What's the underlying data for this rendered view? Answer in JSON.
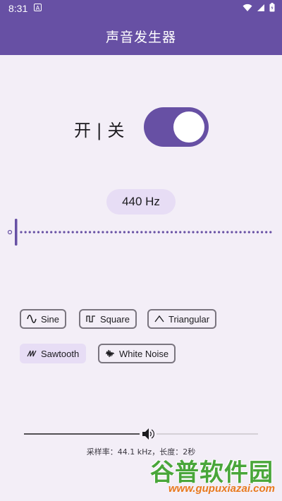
{
  "status_bar": {
    "time": "8:31",
    "notification_glyph": "A"
  },
  "app_bar": {
    "title": "声音发生器"
  },
  "power": {
    "label": "开 | 关",
    "on": true
  },
  "frequency": {
    "label": "440 Hz",
    "value_hz": 440
  },
  "waveforms": [
    {
      "id": "sine",
      "label": "Sine",
      "icon": "sine-wave-icon",
      "selected": false
    },
    {
      "id": "square",
      "label": "Square",
      "icon": "square-wave-icon",
      "selected": false
    },
    {
      "id": "triangular",
      "label": "Triangular",
      "icon": "triangle-wave-icon",
      "selected": false
    },
    {
      "id": "sawtooth",
      "label": "Sawtooth",
      "icon": "sawtooth-wave-icon",
      "selected": true
    },
    {
      "id": "white_noise",
      "label": "White Noise",
      "icon": "noise-wave-icon",
      "selected": false
    }
  ],
  "volume": {
    "level": 0.53,
    "icon": "speaker-icon"
  },
  "info": {
    "text": "采样率：44.1 kHz，长度：2秒"
  },
  "watermark": {
    "title": "谷普软件园",
    "url": "www.gupuxiazai.com"
  },
  "colors": {
    "primary": "#6750A4",
    "background": "#F3EEF7",
    "chip": "#E7DDF5",
    "outline": "#7A757F"
  }
}
